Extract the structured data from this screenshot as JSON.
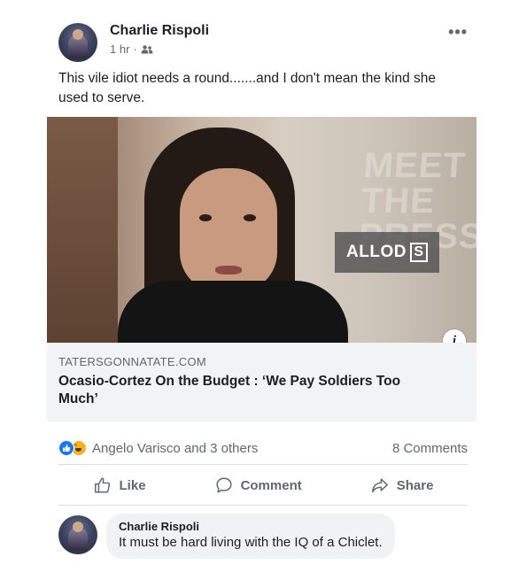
{
  "post": {
    "author": "Charlie Rispoli",
    "time": "1 hr",
    "separator": "·",
    "audience_icon": "friends-icon",
    "more_label": "•••",
    "text": "This vile idiot needs a round.......and I don't mean the kind she used to serve."
  },
  "link": {
    "image_sign_text": "MEET THE PRESS",
    "watermark": "ALLOD",
    "watermark_box": "S",
    "info_label": "i",
    "domain": "TATERSGONNATATE.COM",
    "title": "Ocasio-Cortez On the Budget : ‘We Pay Soldiers Too Much’"
  },
  "reactions": {
    "icons": [
      "like-icon",
      "haha-icon"
    ],
    "names": "Angelo Varisco and 3 others",
    "comments": "8 Comments"
  },
  "actions": {
    "like": "Like",
    "comment": "Comment",
    "share": "Share"
  },
  "comment": {
    "author": "Charlie Rispoli",
    "text": "It must be hard living with the IQ of a Chiclet."
  },
  "colors": {
    "link_blue": "#1877f2",
    "secondary_text": "#606770",
    "card_bg": "#f2f3f5"
  }
}
